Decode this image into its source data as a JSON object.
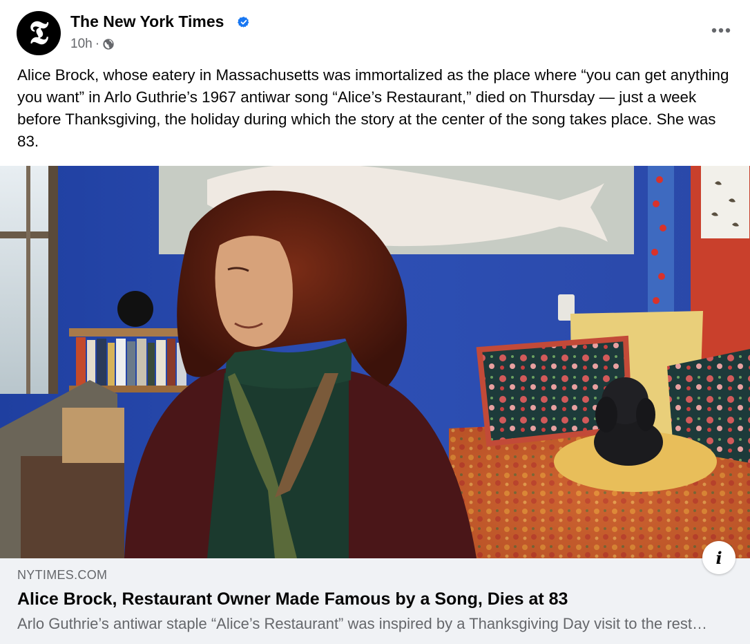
{
  "post": {
    "page_name": "The New York Times",
    "avatar_glyph": "𝕿",
    "timestamp": "10h",
    "separator": "·",
    "caption": "Alice Brock, whose eatery in Massachusetts was immortalized as the place where “you can get anything you want” in Arlo Guthrie’s 1967 antiwar song “Alice’s Restaurant,” died on Thursday — just a week before Thanksgiving, the holiday during which the story at the center of the song takes place. She was 83."
  },
  "icons": {
    "verified": "verified-badge-icon",
    "audience": "globe-icon",
    "more": "more-options-icon",
    "info": "info-icon"
  },
  "link": {
    "domain": "NYTIMES.COM",
    "title": "Alice Brock, Restaurant Owner Made Famous by a Song, Dies at 83",
    "description": "Arlo Guthrie’s antiwar staple “Alice’s Restaurant” was inspired by a Thanksgiving Day visit to the restaurant she ran with her husband."
  },
  "info_button": {
    "glyph": "i"
  },
  "colors": {
    "verified_blue": "#1877f2",
    "secondary_text": "#65676b",
    "link_box_bg": "#f0f2f5"
  }
}
